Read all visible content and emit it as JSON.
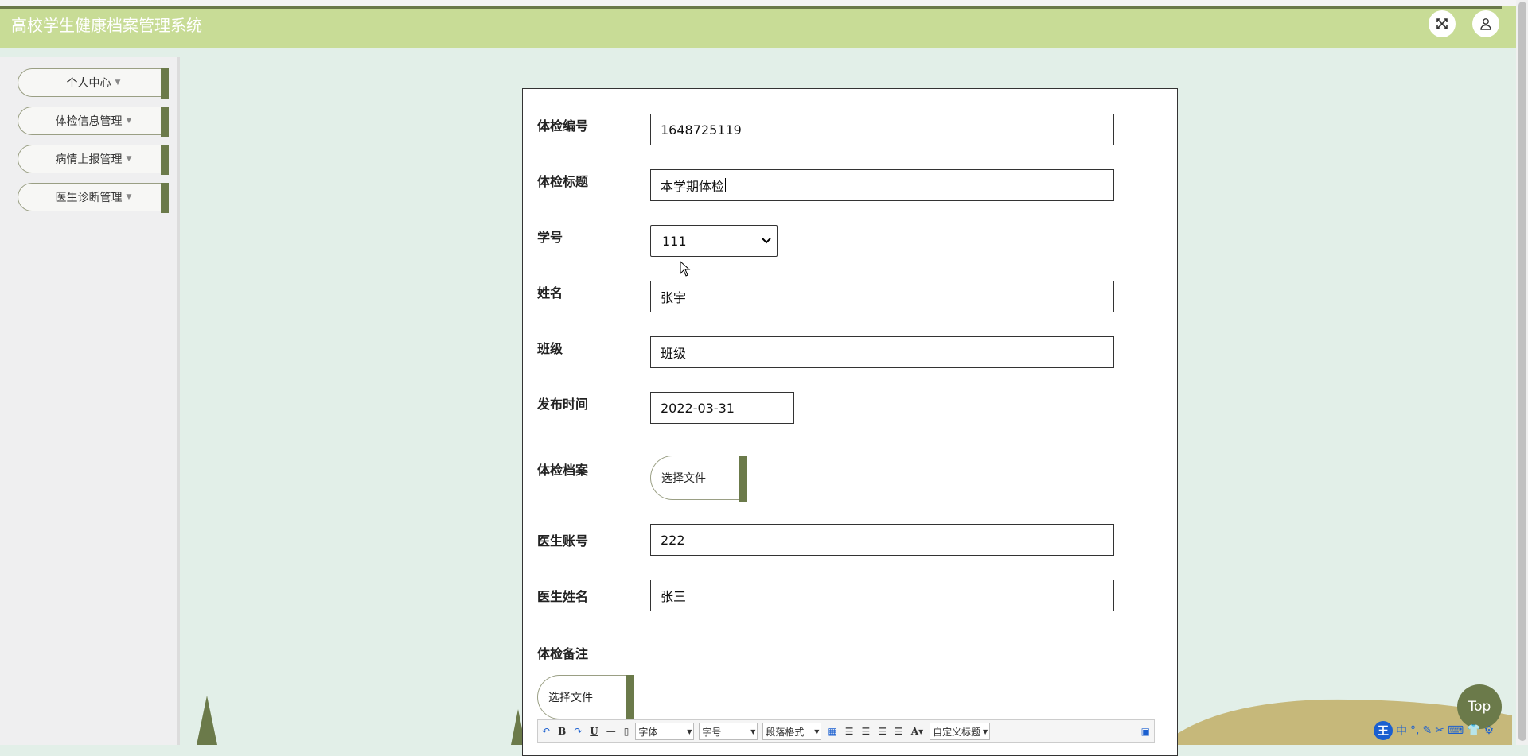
{
  "header": {
    "title": "高校学生健康档案管理系统",
    "fullscreen_icon": "fullscreen-icon",
    "user_icon": "user-icon"
  },
  "sidebar": {
    "items": [
      {
        "label": "个人中心"
      },
      {
        "label": "体检信息管理"
      },
      {
        "label": "病情上报管理"
      },
      {
        "label": "医生诊断管理"
      }
    ]
  },
  "form": {
    "exam_no": {
      "label": "体检编号",
      "value": "1648725119"
    },
    "exam_title": {
      "label": "体检标题",
      "value": "本学期体检"
    },
    "student_no": {
      "label": "学号",
      "value": "111"
    },
    "name": {
      "label": "姓名",
      "value": "张宇"
    },
    "class": {
      "label": "班级",
      "value": "班级"
    },
    "publish_time": {
      "label": "发布时间",
      "value": "2022-03-31"
    },
    "exam_file": {
      "label": "体检档案",
      "button": "选择文件"
    },
    "doctor_account": {
      "label": "医生账号",
      "value": "222"
    },
    "doctor_name": {
      "label": "医生姓名",
      "value": "张三"
    },
    "remark": {
      "label": "体检备注",
      "button": "选择文件"
    }
  },
  "editor_toolbar": {
    "font_family": "字体",
    "font_size": "字号",
    "paragraph": "段落格式",
    "custom_title": "自定义标题",
    "font_color": "A"
  },
  "top_button": "Top",
  "ime": {
    "logo": "王",
    "mode": "中"
  },
  "colors": {
    "header_bg": "#c8dc96",
    "accent": "#6b7a4a",
    "page_bg": "#e2efe8",
    "sidebar_bg": "#efeff0"
  }
}
